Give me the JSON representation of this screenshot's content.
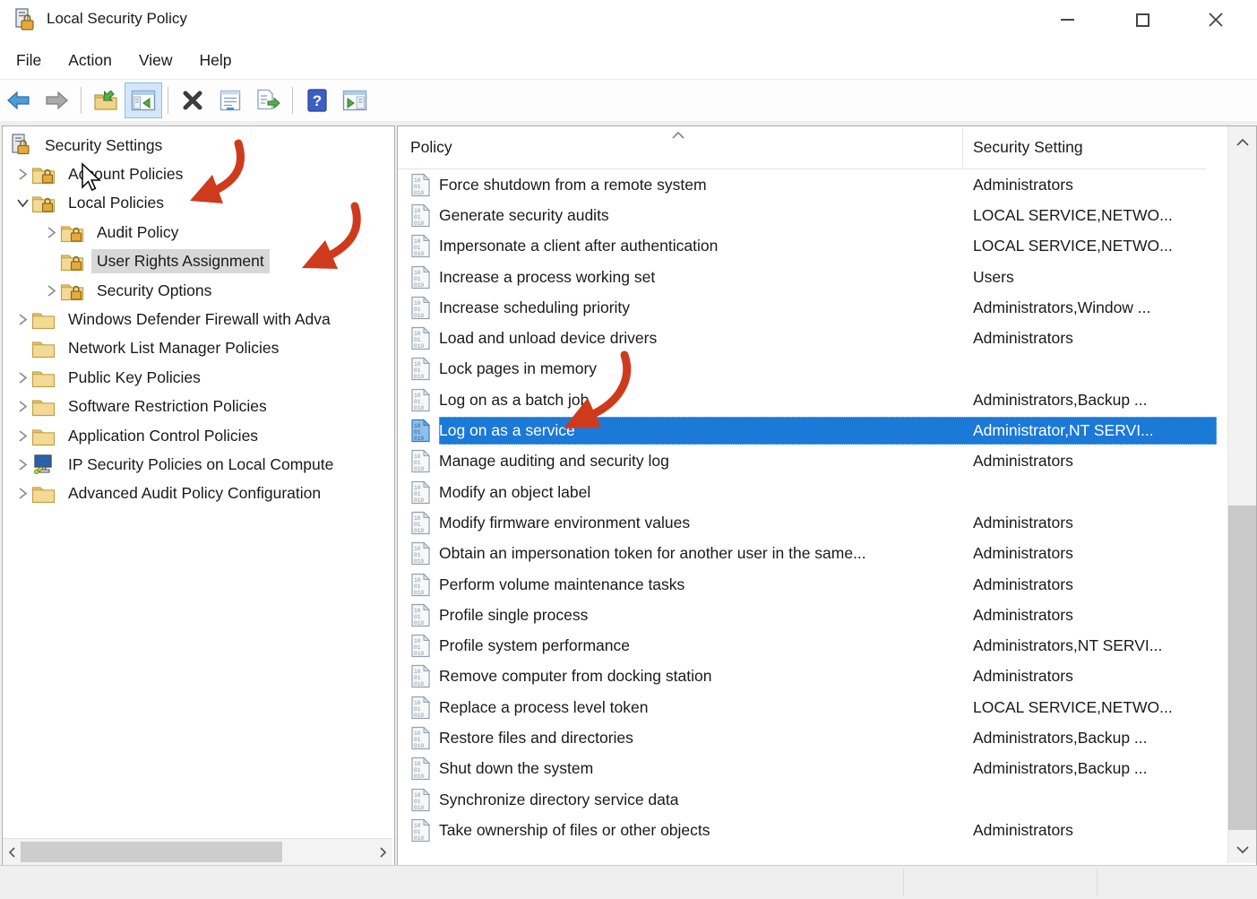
{
  "window": {
    "title": "Local Security Policy",
    "controls": [
      "minimize",
      "maximize",
      "close"
    ]
  },
  "menu": {
    "items": [
      "File",
      "Action",
      "View",
      "Help"
    ]
  },
  "toolbar": {
    "buttons": [
      {
        "name": "back-button",
        "icon": "back-arrow"
      },
      {
        "name": "forward-button",
        "icon": "forward-arrow"
      },
      {
        "name": "separator"
      },
      {
        "name": "up-one-level-button",
        "icon": "folder-up-arrow"
      },
      {
        "name": "show-console-tree-button",
        "icon": "console-tree",
        "active": true
      },
      {
        "name": "separator"
      },
      {
        "name": "delete-button",
        "icon": "delete-x"
      },
      {
        "name": "properties-button",
        "icon": "properties-window"
      },
      {
        "name": "export-list-button",
        "icon": "export-list"
      },
      {
        "name": "separator"
      },
      {
        "name": "help-button",
        "icon": "help-question"
      },
      {
        "name": "show-action-pane-button",
        "icon": "action-pane"
      }
    ]
  },
  "tree": {
    "items": [
      {
        "label": "Security Settings",
        "level": 0,
        "chevron": "none",
        "icon": "computer-lock",
        "selected": false
      },
      {
        "label": "Account Policies",
        "level": 1,
        "chevron": "collapsed",
        "icon": "folder-lock",
        "selected": false
      },
      {
        "label": "Local Policies",
        "level": 1,
        "chevron": "expanded",
        "icon": "folder-lock",
        "selected": false
      },
      {
        "label": "Audit Policy",
        "level": 2,
        "chevron": "collapsed",
        "icon": "folder-lock",
        "selected": false
      },
      {
        "label": "User Rights Assignment",
        "level": 2,
        "chevron": "none",
        "icon": "folder-lock",
        "selected": true
      },
      {
        "label": "Security Options",
        "level": 2,
        "chevron": "collapsed",
        "icon": "folder-lock",
        "selected": false
      },
      {
        "label": "Windows Defender Firewall with Adva",
        "level": 1,
        "chevron": "collapsed",
        "icon": "folder",
        "selected": false
      },
      {
        "label": "Network List Manager Policies",
        "level": 1,
        "chevron": "none",
        "icon": "folder",
        "selected": false
      },
      {
        "label": "Public Key Policies",
        "level": 1,
        "chevron": "collapsed",
        "icon": "folder",
        "selected": false
      },
      {
        "label": "Software Restriction Policies",
        "level": 1,
        "chevron": "collapsed",
        "icon": "folder",
        "selected": false
      },
      {
        "label": "Application Control Policies",
        "level": 1,
        "chevron": "collapsed",
        "icon": "folder",
        "selected": false
      },
      {
        "label": "IP Security Policies on Local Compute",
        "level": 1,
        "chevron": "collapsed",
        "icon": "computer-key",
        "selected": false
      },
      {
        "label": "Advanced Audit Policy Configuration",
        "level": 1,
        "chevron": "collapsed",
        "icon": "folder",
        "selected": false
      }
    ]
  },
  "list": {
    "columns": [
      "Policy",
      "Security Setting"
    ],
    "rows": [
      {
        "policy": "Force shutdown from a remote system",
        "setting": "Administrators",
        "selected": false
      },
      {
        "policy": "Generate security audits",
        "setting": "LOCAL SERVICE,NETWO...",
        "selected": false
      },
      {
        "policy": "Impersonate a client after authentication",
        "setting": "LOCAL SERVICE,NETWO...",
        "selected": false
      },
      {
        "policy": "Increase a process working set",
        "setting": "Users",
        "selected": false
      },
      {
        "policy": "Increase scheduling priority",
        "setting": "Administrators,Window ...",
        "selected": false
      },
      {
        "policy": "Load and unload device drivers",
        "setting": "Administrators",
        "selected": false
      },
      {
        "policy": "Lock pages in memory",
        "setting": "",
        "selected": false
      },
      {
        "policy": "Log on as a batch job",
        "setting": "Administrators,Backup ...",
        "selected": false
      },
      {
        "policy": "Log on as a service",
        "setting": "Administrator,NT SERVI...",
        "selected": true
      },
      {
        "policy": "Manage auditing and security log",
        "setting": "Administrators",
        "selected": false
      },
      {
        "policy": "Modify an object label",
        "setting": "",
        "selected": false
      },
      {
        "policy": "Modify firmware environment values",
        "setting": "Administrators",
        "selected": false
      },
      {
        "policy": "Obtain an impersonation token for another user in the same...",
        "setting": "Administrators",
        "selected": false
      },
      {
        "policy": "Perform volume maintenance tasks",
        "setting": "Administrators",
        "selected": false
      },
      {
        "policy": "Profile single process",
        "setting": "Administrators",
        "selected": false
      },
      {
        "policy": "Profile system performance",
        "setting": "Administrators,NT SERVI...",
        "selected": false
      },
      {
        "policy": "Remove computer from docking station",
        "setting": "Administrators",
        "selected": false
      },
      {
        "policy": "Replace a process level token",
        "setting": "LOCAL SERVICE,NETWO...",
        "selected": false
      },
      {
        "policy": "Restore files and directories",
        "setting": "Administrators,Backup ...",
        "selected": false
      },
      {
        "policy": "Shut down the system",
        "setting": "Administrators,Backup ...",
        "selected": false
      },
      {
        "policy": "Synchronize directory service data",
        "setting": "",
        "selected": false
      },
      {
        "policy": "Take ownership of files or other objects",
        "setting": "Administrators",
        "selected": false
      }
    ]
  },
  "annotations": {
    "arrow_color": "#cf3a1d",
    "arrows": [
      "local-policies",
      "user-rights-assignment",
      "log-on-as-a-service"
    ]
  },
  "colors": {
    "selection_blue": "#1b79d7",
    "tree_selection_gray": "#d8d8d8",
    "arrow_red": "#cf3a1d"
  }
}
